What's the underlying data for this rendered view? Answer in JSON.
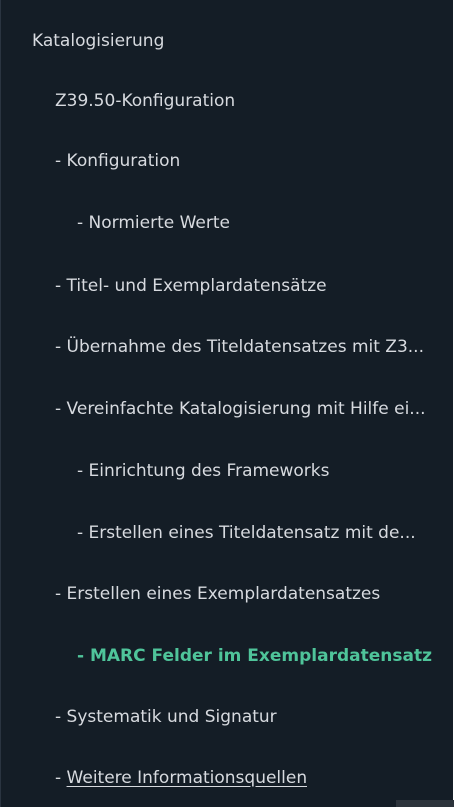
{
  "nav": {
    "items": [
      {
        "label": "Katalogisierung",
        "prefix": ""
      },
      {
        "label": "Z39.50-Konfiguration",
        "prefix": ""
      },
      {
        "label": "Konfiguration",
        "prefix": "- "
      },
      {
        "label": "Normierte Werte",
        "prefix": "- "
      },
      {
        "label": "Titel- und Exemplardatensätze",
        "prefix": "- "
      },
      {
        "label": "Übernahme des Titeldatensatzes mit Z3...",
        "prefix": "- "
      },
      {
        "label": "Vereinfachte Katalogisierung mit Hilfe ei...",
        "prefix": "- "
      },
      {
        "label": "Einrichtung des Frameworks",
        "prefix": "- "
      },
      {
        "label": "Erstellen eines Titeldatensatz mit de...",
        "prefix": "- "
      },
      {
        "label": "Erstellen eines Exemplardatensatzes",
        "prefix": "- "
      },
      {
        "label": "MARC Felder im Exemplardatensatz",
        "prefix": "- "
      },
      {
        "label": "Systematik und Signatur",
        "prefix": "- "
      },
      {
        "label": "Weitere Informationsquellen",
        "prefix": "- "
      }
    ]
  },
  "colors": {
    "background": "#141d26",
    "text": "#d7dadf",
    "active": "#4fc49a"
  }
}
